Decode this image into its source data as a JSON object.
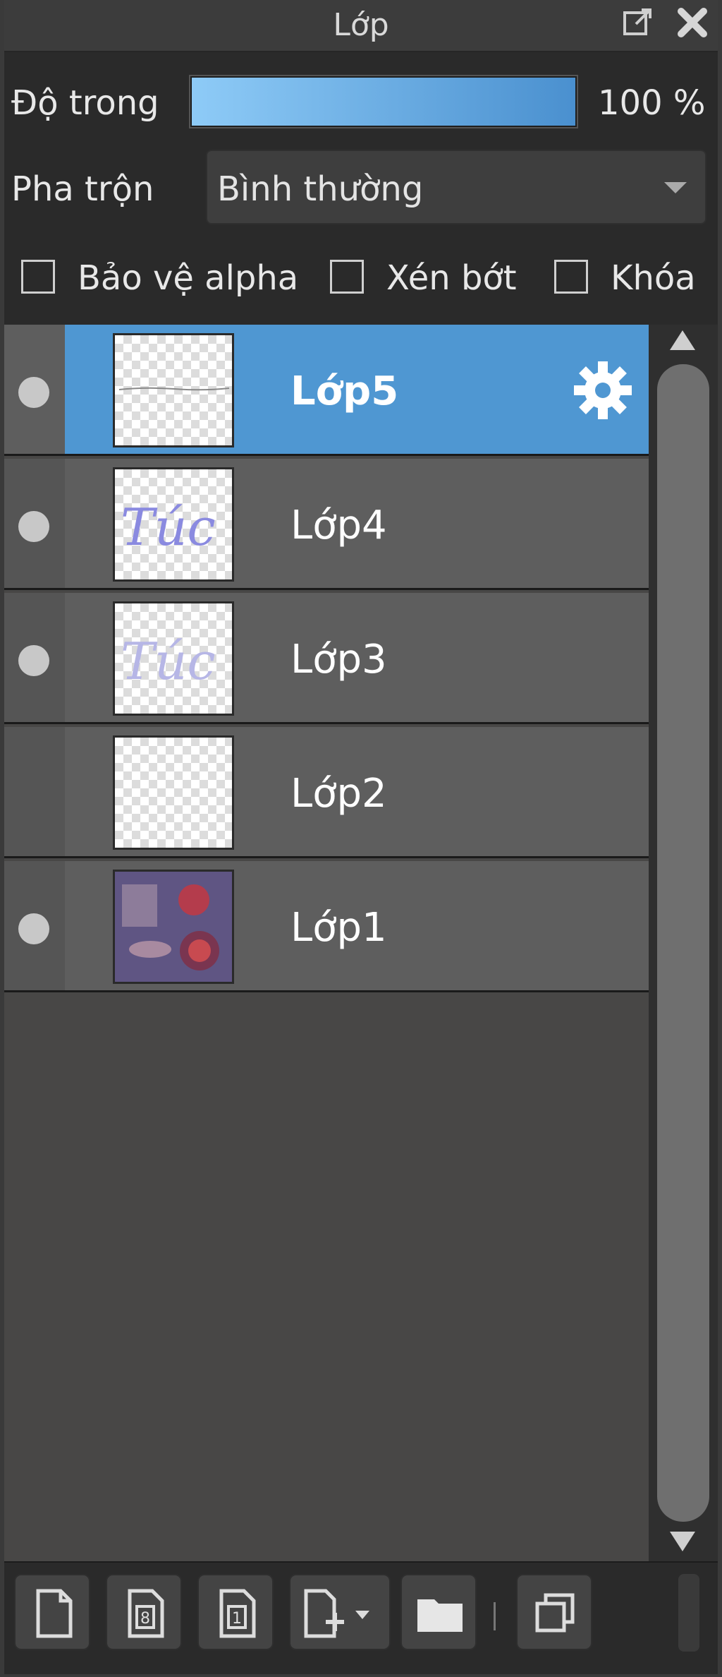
{
  "panel": {
    "title": "Lớp"
  },
  "opacity": {
    "label": "Độ trong",
    "value_text": "100 %",
    "value": 1.0
  },
  "blend": {
    "label": "Pha trộn",
    "selected": "Bình thường"
  },
  "checkboxes": [
    {
      "label": "Bảo vệ alpha",
      "checked": false
    },
    {
      "label": "Xén bớt",
      "checked": false
    },
    {
      "label": "Khóa",
      "checked": false
    }
  ],
  "layers": [
    {
      "name": "Lớp5",
      "selected": true,
      "visible": true,
      "thumb": "stroke"
    },
    {
      "name": "Lớp4",
      "selected": false,
      "visible": true,
      "thumb": "script",
      "thumb_text": "Túc"
    },
    {
      "name": "Lớp3",
      "selected": false,
      "visible": true,
      "thumb": "script-faint",
      "thumb_text": "Túc"
    },
    {
      "name": "Lớp2",
      "selected": false,
      "visible": false,
      "thumb": "blank"
    },
    {
      "name": "Lớp1",
      "selected": false,
      "visible": true,
      "thumb": "photo"
    }
  ],
  "toolbar": {
    "buttons": [
      "new-layer-icon",
      "new-8bit-layer-icon",
      "new-1bit-layer-icon",
      "add-layer-menu-icon",
      "folder-icon",
      "duplicate-layer-icon"
    ]
  },
  "colors": {
    "selected": "#4f97d2",
    "panel_bg": "#2a2a2a",
    "layer_bg": "#5e5e5e"
  }
}
